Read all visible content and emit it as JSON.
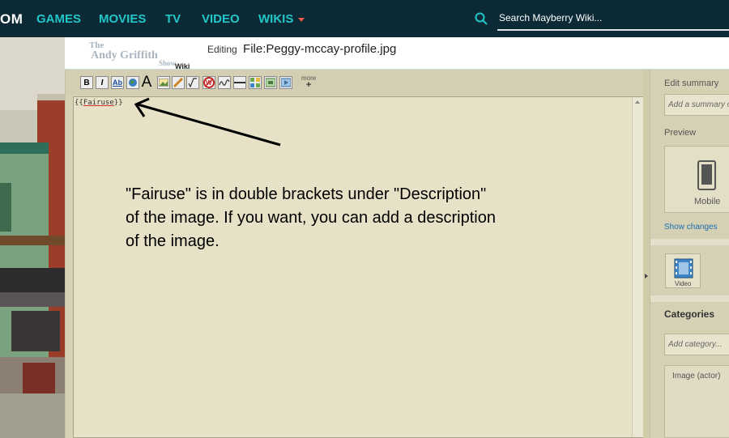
{
  "topnav": {
    "brand": "OM",
    "items": [
      {
        "label": "GAMES"
      },
      {
        "label": "MOVIES"
      },
      {
        "label": "TV"
      },
      {
        "label": "VIDEO"
      },
      {
        "label": "WIKIS"
      }
    ],
    "search_placeholder": "Search Mayberry Wiki..."
  },
  "header": {
    "logo_line1": "The",
    "logo_line2": "Andy Griffith",
    "logo_line3": "Show",
    "logo_line4": "Wiki",
    "editing_label": "Editing",
    "file_title": "File:Peggy-mccay-profile.jpg"
  },
  "toolbar": {
    "bold": "B",
    "italic": "I",
    "link": "Ab",
    "heading": "A",
    "more_label": "more",
    "more_plus": "+"
  },
  "editor": {
    "open_brace": "{{",
    "template_word": "Fairuse",
    "close_brace": "}}"
  },
  "annotation": {
    "line1": "\"Fairuse\" is in double brackets under \"Description\"",
    "line2": "of the image. If you want, you can add a description",
    "line3": "of the image."
  },
  "rail": {
    "edit_summary_label": "Edit summary",
    "edit_summary_placeholder": "Add a summary o",
    "preview_label": "Preview",
    "mobile_label": "Mobile",
    "show_changes": "Show changes",
    "video_label": "Video",
    "categories_label": "Categories",
    "add_category_placeholder": "Add category...",
    "category_item": "Image (actor)"
  },
  "colors": {
    "nav_bg": "#0b2a35",
    "nav_link": "#23c6c8",
    "editor_bg": "#d8d3b6",
    "link": "#1a6fb0"
  }
}
